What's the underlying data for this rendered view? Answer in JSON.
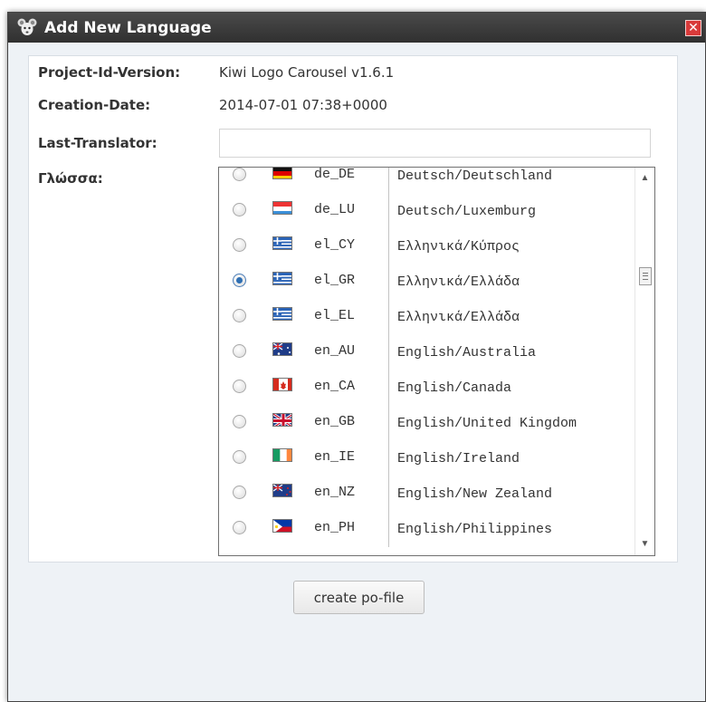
{
  "dialog": {
    "title": "Add New Language",
    "close_glyph": "✕",
    "title_icon": "rat-logo-icon"
  },
  "fields": [
    {
      "label": "Project-Id-Version:",
      "value": "Kiwi Logo Carousel v1.6.1"
    },
    {
      "label": "Creation-Date:",
      "value": "2014-07-01 07:38+0000"
    }
  ],
  "translator": {
    "label": "Last-Translator:",
    "value": ""
  },
  "language": {
    "label": "Γλώσσα:",
    "selected": "el_GR",
    "options": [
      {
        "code": "de_DE",
        "name": "Deutsch/Deutschland",
        "flag": "germany-flag-icon",
        "checked": false
      },
      {
        "code": "de_LU",
        "name": "Deutsch/Luxemburg",
        "flag": "luxembourg-flag-icon",
        "checked": false
      },
      {
        "code": "el_CY",
        "name": "Ελληνικά/Κύπρος",
        "flag": "greece-flag-icon",
        "checked": false
      },
      {
        "code": "el_GR",
        "name": "Ελληνικά/Ελλάδα",
        "flag": "greece-flag-icon",
        "checked": true
      },
      {
        "code": "el_EL",
        "name": "Ελληνικά/Ελλάδα",
        "flag": "greece-flag-icon",
        "checked": false
      },
      {
        "code": "en_AU",
        "name": "English/Australia",
        "flag": "australia-flag-icon",
        "checked": false
      },
      {
        "code": "en_CA",
        "name": "English/Canada",
        "flag": "canada-flag-icon",
        "checked": false
      },
      {
        "code": "en_GB",
        "name": "English/United Kingdom",
        "flag": "uk-flag-icon",
        "checked": false
      },
      {
        "code": "en_IE",
        "name": "English/Ireland",
        "flag": "ireland-flag-icon",
        "checked": false
      },
      {
        "code": "en_NZ",
        "name": "English/New Zealand",
        "flag": "new-zealand-flag-icon",
        "checked": false
      },
      {
        "code": "en_PH",
        "name": "English/Philippines",
        "flag": "philippines-flag-icon",
        "checked": false
      }
    ]
  },
  "scrollbar": {
    "up_glyph": "▲",
    "down_glyph": "▼"
  },
  "actions": {
    "create_label": "create po-file"
  },
  "colors": {
    "titlebar": "#3a3a3a",
    "close": "#d93a3a",
    "radio_checked": "#2f6fb3",
    "dialog_bg": "#eef2f6"
  }
}
